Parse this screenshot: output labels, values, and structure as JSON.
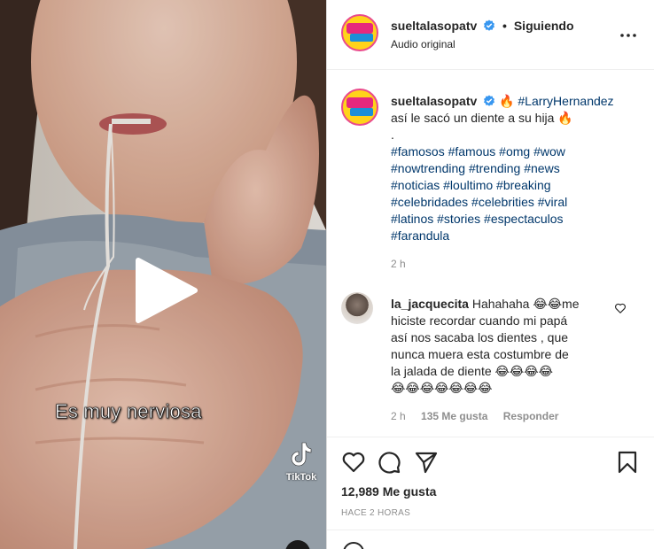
{
  "video": {
    "caption": "Es muy nerviosa",
    "watermark": "TikTok"
  },
  "header": {
    "username": "sueltalasopatv",
    "follow_status": "Siguiendo",
    "audio": "Audio original"
  },
  "post": {
    "username": "sueltalasopatv",
    "emoji_fire": "🔥",
    "mention": "#LarryHernandez",
    "text": "así le sacó un diente a su hija",
    "dot": ".",
    "hashtags_line1": "#famosos #famous #omg #wow",
    "hashtags_line2": "#nowtrending #trending #news",
    "hashtags_line3": "#noticias #loultimo #breaking",
    "hashtags_line4": "#celebridades #celebrities #viral",
    "hashtags_line5": "#latinos #stories #espectaculos",
    "hashtags_line6": "#farandula",
    "time": "2 h"
  },
  "comment": {
    "username": "la_jacquecita",
    "text_line1": "Hahahaha 😂😂me",
    "text_line2": "hiciste recordar cuando mi papá",
    "text_line3": "así nos sacaba los dientes , que",
    "text_line4": "nunca muera esta costumbre de",
    "text_line5": "la jalada de diente 😂😂😂😂",
    "text_line6": "😂😂😂😂😂😂😂",
    "time": "2 h",
    "likes": "135 Me gusta",
    "reply": "Responder"
  },
  "actions": {
    "likes": "12,989 Me gusta",
    "ago": "HACE 2 HORAS"
  },
  "icons": [
    "verified-icon",
    "more-icon",
    "play-icon",
    "heart-icon",
    "comment-icon",
    "share-icon",
    "bookmark-icon",
    "tiktok-icon",
    "emoji-icon"
  ],
  "colors": {
    "link": "#00376b",
    "verified": "#3897f0",
    "muted": "#8e8e8e"
  }
}
